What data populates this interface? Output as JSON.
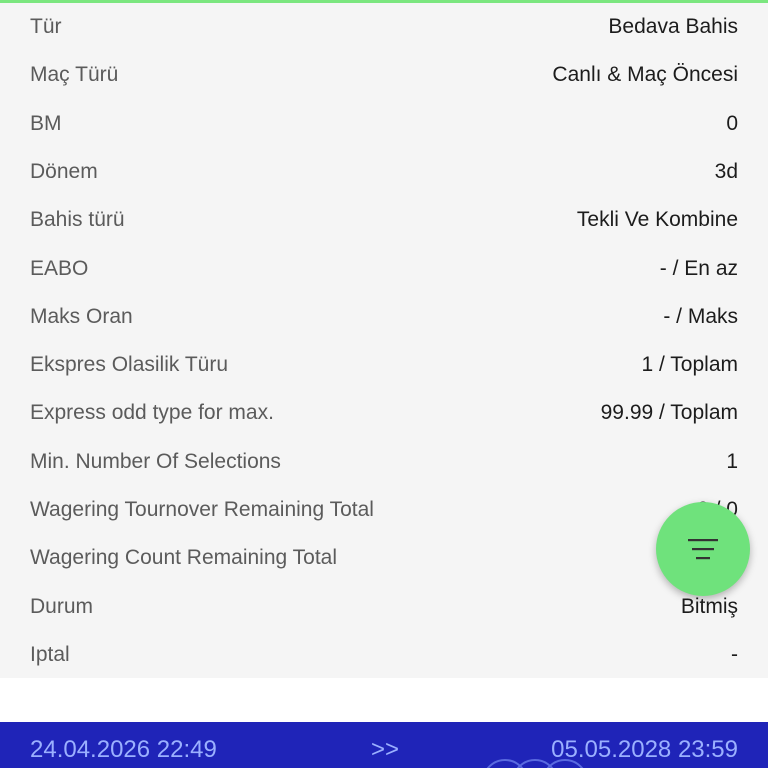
{
  "colors": {
    "accent": "#7be67f",
    "fab": "#6fe27c",
    "footer_bg": "#1f24b8",
    "footer_text": "#9bb0ff"
  },
  "rows": [
    {
      "label": "Tür",
      "value": "Bedava Bahis"
    },
    {
      "label": "Maç Türü",
      "value": "Canlı & Maç Öncesi"
    },
    {
      "label": "BM",
      "value": "0"
    },
    {
      "label": "Dönem",
      "value": "3d"
    },
    {
      "label": "Bahis türü",
      "value": "Tekli Ve Kombine"
    },
    {
      "label": "EABO",
      "value": "- / En az"
    },
    {
      "label": "Maks Oran",
      "value": "- / Maks"
    },
    {
      "label": "Ekspres Olasilik Türu",
      "value": "1 / Toplam"
    },
    {
      "label": "Express odd type for max.",
      "value": "99.99 / Toplam"
    },
    {
      "label": "Min. Number Of Selections",
      "value": "1"
    },
    {
      "label": "Wagering Tournover Remaining Total",
      "value": "0 / 0"
    },
    {
      "label": "Wagering Count Remaining Total",
      "value": ""
    },
    {
      "label": "Durum",
      "value": "Bitmiş"
    },
    {
      "label": "Iptal",
      "value": "-"
    }
  ],
  "fab": {
    "icon": "filter-icon"
  },
  "footer": {
    "start_date": "24.04.2026 22:49",
    "arrow": ">>",
    "end_date": "05.05.2028 23:59"
  }
}
